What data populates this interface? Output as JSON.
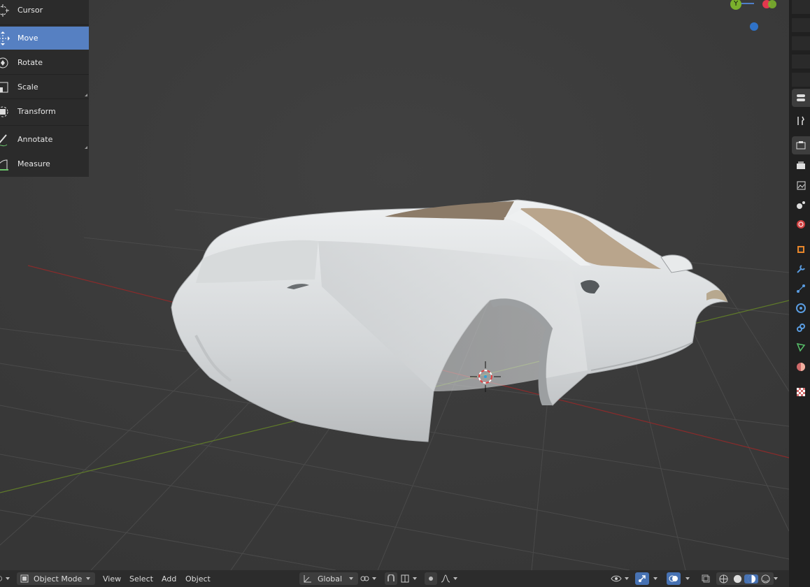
{
  "tools": [
    {
      "label": "Cursor",
      "icon": "cursor-icon",
      "active": false
    },
    {
      "label": "Move",
      "icon": "move-icon",
      "active": true
    },
    {
      "label": "Rotate",
      "icon": "rotate-icon",
      "active": false
    },
    {
      "label": "Scale",
      "icon": "scale-icon",
      "active": false
    },
    {
      "label": "Transform",
      "icon": "transform-icon",
      "active": false
    },
    {
      "label": "Annotate",
      "icon": "annotate-icon",
      "active": false
    },
    {
      "label": "Measure",
      "icon": "measure-icon",
      "active": false
    }
  ],
  "gizmo": {
    "y_label": "Y",
    "y_color": "#7ab02c",
    "x_color": "#e2374e",
    "z_color": "#2f72c7"
  },
  "header": {
    "mode_label": "Object Mode",
    "menu_view": "View",
    "menu_select": "Select",
    "menu_add": "Add",
    "menu_object": "Object",
    "orientation_label": "Global"
  },
  "properties_tabs": [
    "tool-icon",
    "render-icon",
    "output-icon",
    "view-layer-icon",
    "scene-icon",
    "world-icon",
    "object-icon",
    "modifier-icon",
    "particles-icon",
    "physics-icon",
    "constraints-icon",
    "data-icon",
    "material-icon",
    "texture-icon"
  ],
  "colors": {
    "active_tool": "#5680c2",
    "grid_x_axis": "#8a2b2b",
    "grid_y_axis": "#5f7a2a"
  }
}
